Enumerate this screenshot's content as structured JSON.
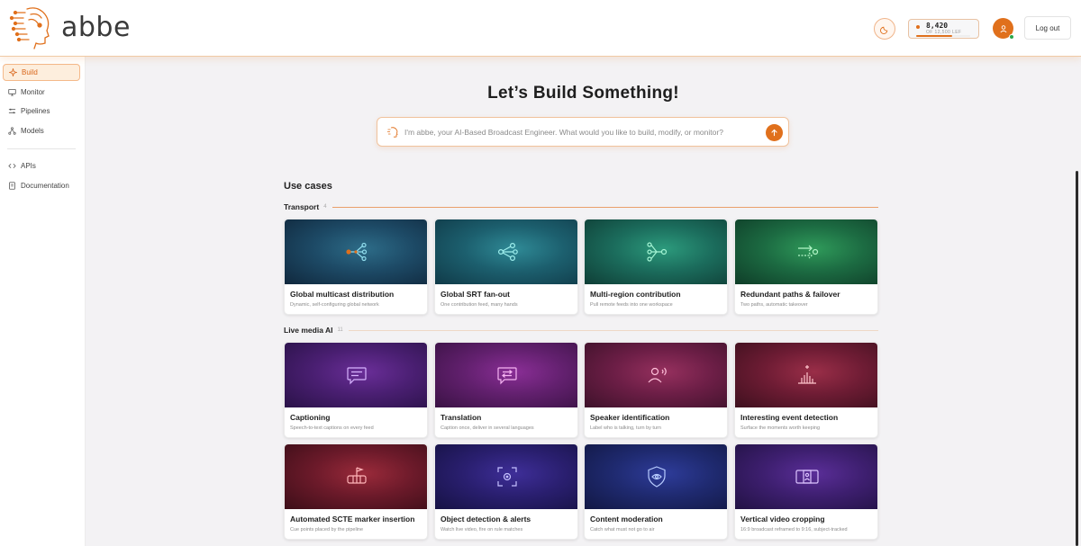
{
  "brand": {
    "name": "abbe",
    "accent": "#e0701c"
  },
  "header": {
    "theme_icon": "moon-icon",
    "credits": {
      "value": "8,420",
      "subtitle": "OF 12,500 LEF",
      "progress": 0.67
    },
    "logout_label": "Log out"
  },
  "sidebar": {
    "items": [
      {
        "label": "Build",
        "icon": "sparkle-icon",
        "active": true
      },
      {
        "label": "Monitor",
        "icon": "monitor-icon"
      },
      {
        "label": "Pipelines",
        "icon": "pipeline-icon"
      },
      {
        "label": "Models",
        "icon": "models-icon"
      }
    ],
    "secondary": [
      {
        "label": "APIs",
        "icon": "code-icon"
      },
      {
        "label": "Documentation",
        "icon": "document-icon"
      }
    ]
  },
  "main": {
    "title": "Let’s Build Something!",
    "prompt_placeholder": "I'm abbe, your AI-Based Broadcast Engineer. What would you like to build, modify, or monitor?",
    "use_cases_title": "Use cases",
    "sections": [
      {
        "name": "Transport",
        "count": "4",
        "cards": [
          {
            "title": "Global multicast distribution",
            "desc": "Dynamic, self-configuring global network"
          },
          {
            "title": "Global SRT fan-out",
            "desc": "One contribution feed, many hands"
          },
          {
            "title": "Multi-region contribution",
            "desc": "Pull remote feeds into one workspace"
          },
          {
            "title": "Redundant paths & failover",
            "desc": "Two paths, automatic takeover"
          }
        ]
      },
      {
        "name": "Live media AI",
        "count": "11",
        "cards": [
          {
            "title": "Captioning",
            "desc": "Speech-to-text captions on every feed"
          },
          {
            "title": "Translation",
            "desc": "Caption once, deliver in several languages"
          },
          {
            "title": "Speaker identification",
            "desc": "Label who is talking, turn by turn"
          },
          {
            "title": "Interesting event detection",
            "desc": "Surface the moments worth keeping"
          },
          {
            "title": "Automated SCTE marker insertion",
            "desc": "Cue points placed by the pipeline"
          },
          {
            "title": "Object detection & alerts",
            "desc": "Watch live video, fire on rule matches"
          },
          {
            "title": "Content moderation",
            "desc": "Catch what must not go to air"
          },
          {
            "title": "Vertical video cropping",
            "desc": "16:9 broadcast reframed to 9:16, subject-tracked"
          }
        ]
      }
    ]
  }
}
